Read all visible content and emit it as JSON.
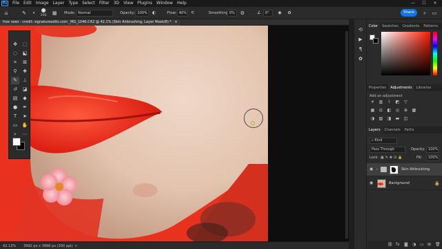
{
  "app": {
    "logo_text": "Ps"
  },
  "menu": [
    "File",
    "Edit",
    "Image",
    "Layer",
    "Type",
    "Select",
    "Filter",
    "3D",
    "View",
    "Plugins",
    "Window",
    "Help"
  ],
  "window_controls": {
    "minimize": "—",
    "maximize": "☐",
    "close": "✕"
  },
  "options_bar": {
    "brush_size": "250",
    "mode_label": "Mode:",
    "mode_value": "Normal",
    "opacity_label": "Opacity:",
    "opacity_value": "100%",
    "flow_label": "Flow:",
    "flow_value": "40%",
    "smoothing_label": "Smoothing:",
    "smoothing_value": "0%",
    "angle_value": "0°",
    "share_label": "Share"
  },
  "document": {
    "tab_title": "free raws - credit: signatureedits.com _MG_1046.CR2 @ 42.1% (Skin Airbrushing, Layer Mask/8) *",
    "close_glyph": "×"
  },
  "statusbar": {
    "zoom": "42.13%",
    "dimensions": "3992 px x 3888 px (300 ppi)",
    "arrow": ">"
  },
  "panels": {
    "color_tabs": [
      "Color",
      "Swatches",
      "Gradients",
      "Patterns"
    ],
    "adjust_tabs": [
      "Properties",
      "Adjustments",
      "Libraries"
    ],
    "add_adjustment": "Add an adjustment",
    "layers_tabs": [
      "Layers",
      "Channels",
      "Paths"
    ],
    "kind_label": "Kind",
    "blend_mode": "Pass Through",
    "opacity_label": "Opacity:",
    "opacity_value": "100%",
    "lock_label": "Lock:",
    "fill_label": "Fill:",
    "fill_value": "100%"
  },
  "layers": [
    {
      "name": "Skin Airbrushing",
      "selected": true,
      "type": "group"
    },
    {
      "name": "Background",
      "selected": false,
      "type": "pixel"
    }
  ],
  "colors": {
    "accent": "#1473e6",
    "foreground": "#ffffff",
    "background": "#000000",
    "backdrop_red": "#e8321e"
  }
}
